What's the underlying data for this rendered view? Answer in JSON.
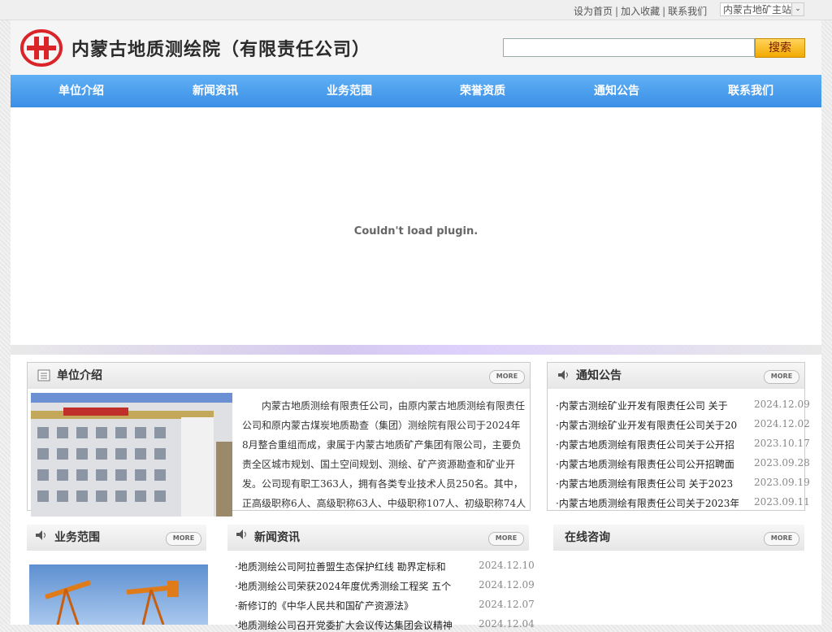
{
  "top": {
    "links": [
      "设为首页",
      "加入收藏",
      "联系我们"
    ],
    "site_select": "内蒙古地矿主站"
  },
  "header": {
    "site_name": "内蒙古地质测绘院（有限责任公司）",
    "search_placeholder": "",
    "search_button": "搜索"
  },
  "nav": [
    "单位介绍",
    "新闻资讯",
    "业务范围",
    "荣誉资质",
    "通知公告",
    "联系我们"
  ],
  "banner": {
    "message": "Couldn't load plugin."
  },
  "about": {
    "title": "单位介绍",
    "more": "MORE",
    "text": "内蒙古地质测绘有限责任公司，由原内蒙古地质测绘有限责任公司和原内蒙古煤炭地质勘查（集团）测绘院有限公司于2024年8月整合重组而成，隶属于内蒙古地质矿产集团有限公司，主要负责全区城市规划、国土空间规划、测绘、矿产资源勘查和矿业开发。公司现有职工363人，拥有各类专业技术人员250名。其中，正高级职称6人、高级职称63人、中级职称107人、初级职称74人"
  },
  "notice": {
    "title": "通知公告",
    "more": "MORE",
    "items": [
      {
        "title": "·内蒙古测绘矿业开发有限责任公司 关于",
        "date": "2024.12.09"
      },
      {
        "title": "·内蒙古测绘矿业开发有限责任公司关于20",
        "date": "2024.12.02"
      },
      {
        "title": "·内蒙古地质测绘有限责任公司关于公开招",
        "date": "2023.10.17"
      },
      {
        "title": "·内蒙古地质测绘有限责任公司公开招聘面",
        "date": "2023.09.28"
      },
      {
        "title": "·内蒙古地质测绘有限责任公司 关于2023",
        "date": "2023.09.19"
      },
      {
        "title": "·内蒙古地质测绘有限责任公司关于2023年",
        "date": "2023.09.11"
      }
    ]
  },
  "scope": {
    "title": "业务范围",
    "more": "MORE"
  },
  "news": {
    "title": "新闻资讯",
    "more": "MORE",
    "items": [
      {
        "title": "·地质测绘公司阿拉善盟生态保护红线 勘界定标和",
        "date": "2024.12.10"
      },
      {
        "title": "·地质测绘公司荣获2024年度优秀测绘工程奖 五个",
        "date": "2024.12.09"
      },
      {
        "title": "·新修订的《中华人民共和国矿产资源法》",
        "date": "2024.12.07"
      },
      {
        "title": "·地质测绘公司召开党委扩大会议传达集团会议精神",
        "date": "2024.12.04"
      }
    ]
  },
  "consult": {
    "title": "在线咨询",
    "more": "MORE"
  },
  "colors": {
    "nav": "#3b8fe6",
    "logo_red": "#d9252a",
    "search_btn": "#f2a900"
  }
}
